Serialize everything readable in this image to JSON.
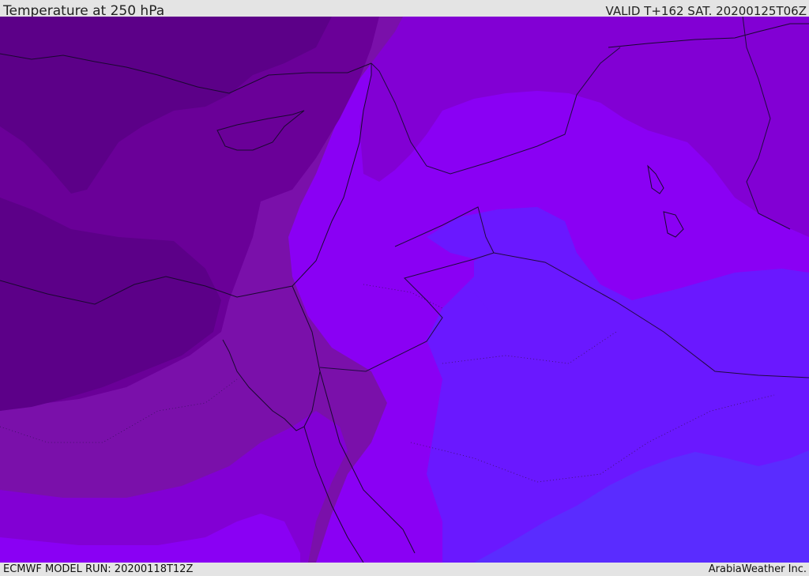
{
  "header": {
    "title": "Temperature at 250 hPa",
    "valid": "VALID T+162 SAT. 20200125T06Z"
  },
  "footer": {
    "model_run": "ECMWF MODEL RUN: 20200118T12Z",
    "credit": "ArabiaWeather Inc."
  },
  "colors": {
    "band_coldest": "#5c0088",
    "band_2": "#6a0098",
    "band_3": "#7a10aa",
    "band_4": "#8200d4",
    "band_5": "#8a00f4",
    "band_6": "#6a18ff",
    "band_warmest": "#5a2cff",
    "coastline": "#1a0830",
    "border": "#200a40"
  }
}
